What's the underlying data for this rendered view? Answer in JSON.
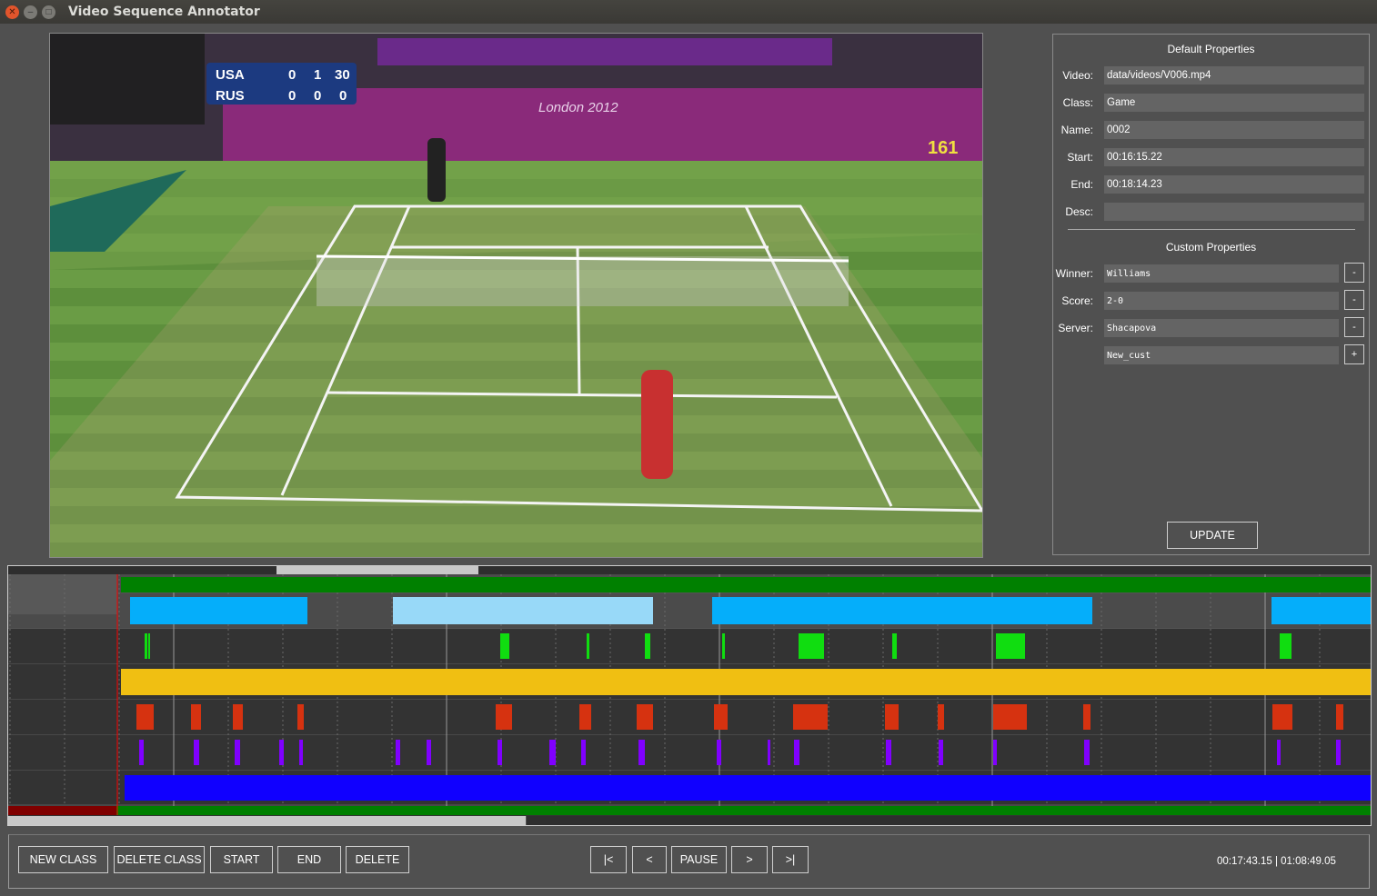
{
  "window": {
    "title": "Video Sequence Annotator",
    "controls": [
      "close",
      "minimize",
      "maximize"
    ]
  },
  "video": {
    "banner": "London 2012",
    "scoreboard": {
      "rows": [
        {
          "team": "USA",
          "scores": [
            "0",
            "1",
            "30"
          ]
        },
        {
          "team": "RUS",
          "scores": [
            "0",
            "0",
            "0"
          ]
        }
      ]
    },
    "speed": "161"
  },
  "default_properties": {
    "title": "Default Properties",
    "fields": [
      {
        "label": "Video:",
        "value": "data/videos/V006.mp4"
      },
      {
        "label": "Class:",
        "value": "Game"
      },
      {
        "label": "Name:",
        "value": "0002"
      },
      {
        "label": "Start:",
        "value": "00:16:15.22"
      },
      {
        "label": "End:",
        "value": "00:18:14.23"
      },
      {
        "label": "Desc:",
        "value": ""
      }
    ]
  },
  "custom_properties": {
    "title": "Custom Properties",
    "fields": [
      {
        "label": "Winner:",
        "value": "Williams",
        "button": "-"
      },
      {
        "label": "Score:",
        "value": "2-0",
        "button": "-"
      },
      {
        "label": "Server:",
        "value": "Shacapova",
        "button": "-"
      },
      {
        "label": "",
        "value": "New_cust",
        "button": "+"
      }
    ]
  },
  "update_label": "UPDATE",
  "timeline": {
    "track_colors": [
      "#008000",
      "#05aefa",
      "#10dd10",
      "#f0bf12",
      "#d63210",
      "#8000ff",
      "#1000ff"
    ],
    "selected_color": "#98d9f8",
    "cursor_color": "#ff0000",
    "played_color": "#800000",
    "scroll_fraction": 0.38
  },
  "toolbar": {
    "new_class": "NEW CLASS",
    "delete_class": "DELETE CLASS",
    "start": "START",
    "end": "END",
    "delete": "DELETE",
    "first": "|<",
    "prev": "<",
    "pause": "PAUSE",
    "next": ">",
    "last": ">|"
  },
  "time": {
    "current": "00:17:43.15",
    "total": "01:08:49.05",
    "display": "00:17:43.15 | 01:08:49.05"
  }
}
